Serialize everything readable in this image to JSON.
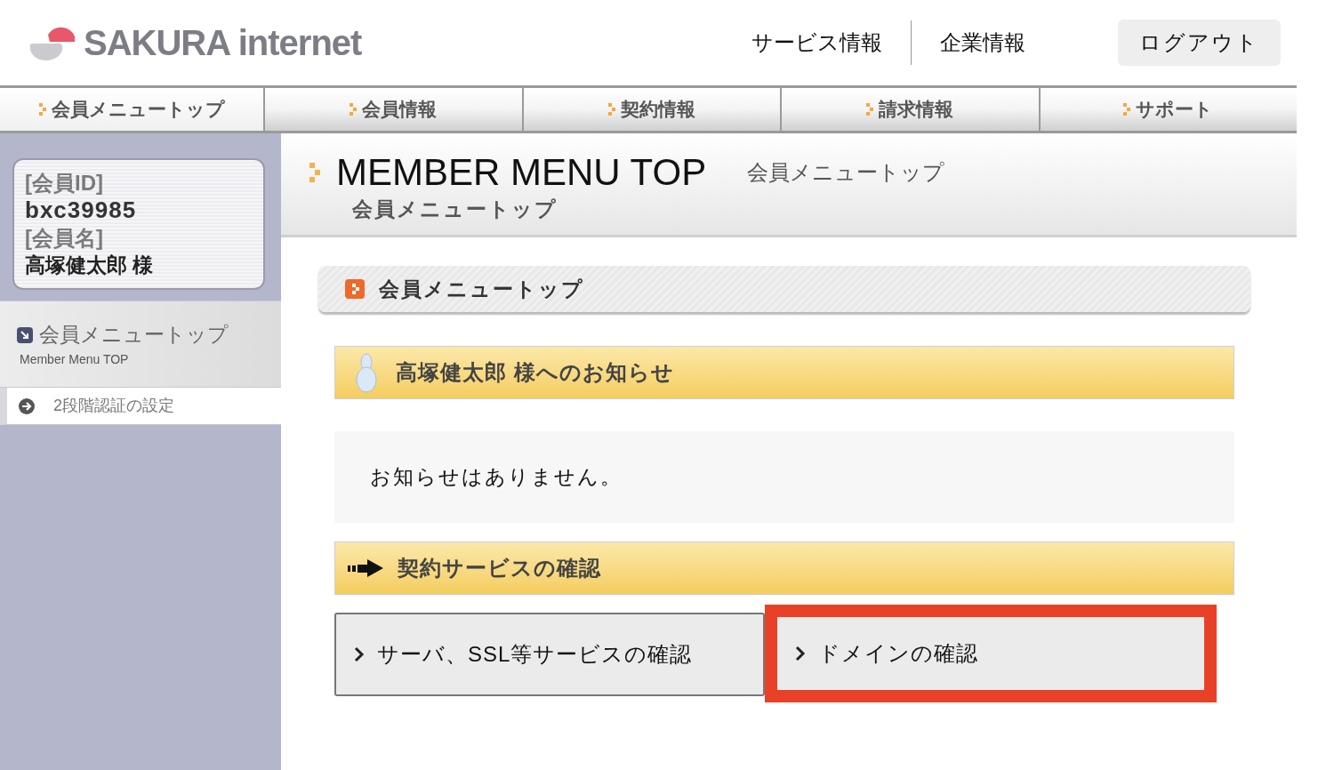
{
  "header": {
    "logo": "SAKURA internet",
    "links": [
      "サービス情報",
      "企業情報"
    ],
    "logout": "ログアウト"
  },
  "nav_tabs": [
    {
      "label": "会員メニュートップ",
      "selected": true
    },
    {
      "label": "会員情報",
      "selected": false
    },
    {
      "label": "契約情報",
      "selected": false
    },
    {
      "label": "請求情報",
      "selected": false
    },
    {
      "label": "サポート",
      "selected": false
    }
  ],
  "member_card": {
    "id_label": "[会員ID]",
    "id": "bxc39985",
    "name_label": "[会員名]",
    "name": "高塚健太郎 様"
  },
  "sidebar": {
    "title": "会員メニュートップ",
    "subtitle": "Member Menu TOP",
    "items": [
      "2段階認証の設定"
    ]
  },
  "page_header": {
    "title": "MEMBER MENU TOP",
    "title_ja": "会員メニュートップ",
    "breadcrumb": "会員メニュートップ"
  },
  "section_title": "会員メニュートップ",
  "notice": {
    "heading": "高塚健太郎 様へのお知らせ",
    "message": "お知らせはありません。"
  },
  "services": {
    "heading": "契約サービスの確認",
    "buttons": [
      {
        "label": "サーバ、SSL等サービスの確認",
        "highlighted": false
      },
      {
        "label": "ドメインの確認",
        "highlighted": true
      }
    ]
  }
}
